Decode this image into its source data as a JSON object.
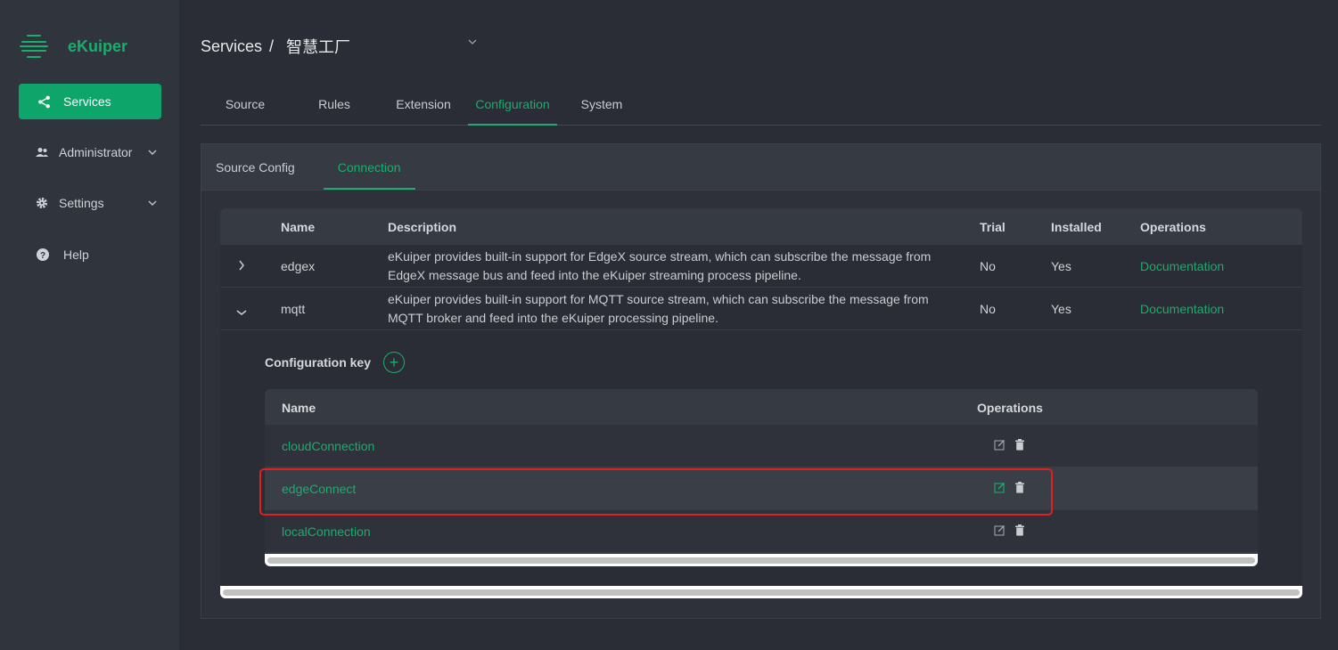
{
  "app": {
    "name": "eKuiper",
    "brand_color": "#1aad6e"
  },
  "sidebar": {
    "items": [
      {
        "label": "Services",
        "icon": "share-icon",
        "active": true
      },
      {
        "label": "Administrator",
        "icon": "users-icon"
      },
      {
        "label": "Settings",
        "icon": "gear-icon"
      },
      {
        "label": "Help",
        "icon": "help-icon"
      }
    ]
  },
  "breadcrumb": {
    "root": "Services",
    "separator": "/",
    "current": "智慧工厂"
  },
  "tabs": [
    "Source",
    "Rules",
    "Extension",
    "Configuration",
    "System"
  ],
  "active_tab": "Configuration",
  "subtabs": [
    "Source Config",
    "Connection"
  ],
  "active_subtab": "Connection",
  "table": {
    "headers": {
      "name": "Name",
      "description": "Description",
      "trial": "Trial",
      "installed": "Installed",
      "operations": "Operations"
    },
    "rows": [
      {
        "name": "edgex",
        "description": "eKuiper provides built-in support for EdgeX source stream, which can subscribe the message from EdgeX message bus and feed into the eKuiper streaming process pipeline.",
        "trial": "No",
        "installed": "Yes",
        "operation": "Documentation"
      },
      {
        "name": "mqtt",
        "description": "eKuiper provides built-in support for MQTT source stream, which can subscribe the message from MQTT broker and feed into the eKuiper processing pipeline.",
        "trial": "No",
        "installed": "Yes",
        "operation": "Documentation"
      }
    ]
  },
  "config_key": {
    "title": "Configuration key",
    "add_symbol": "+",
    "headers": {
      "name": "Name",
      "operations": "Operations"
    },
    "rows": [
      {
        "name": "cloudConnection"
      },
      {
        "name": "edgeConnect",
        "highlighted": true
      },
      {
        "name": "localConnection"
      }
    ]
  }
}
